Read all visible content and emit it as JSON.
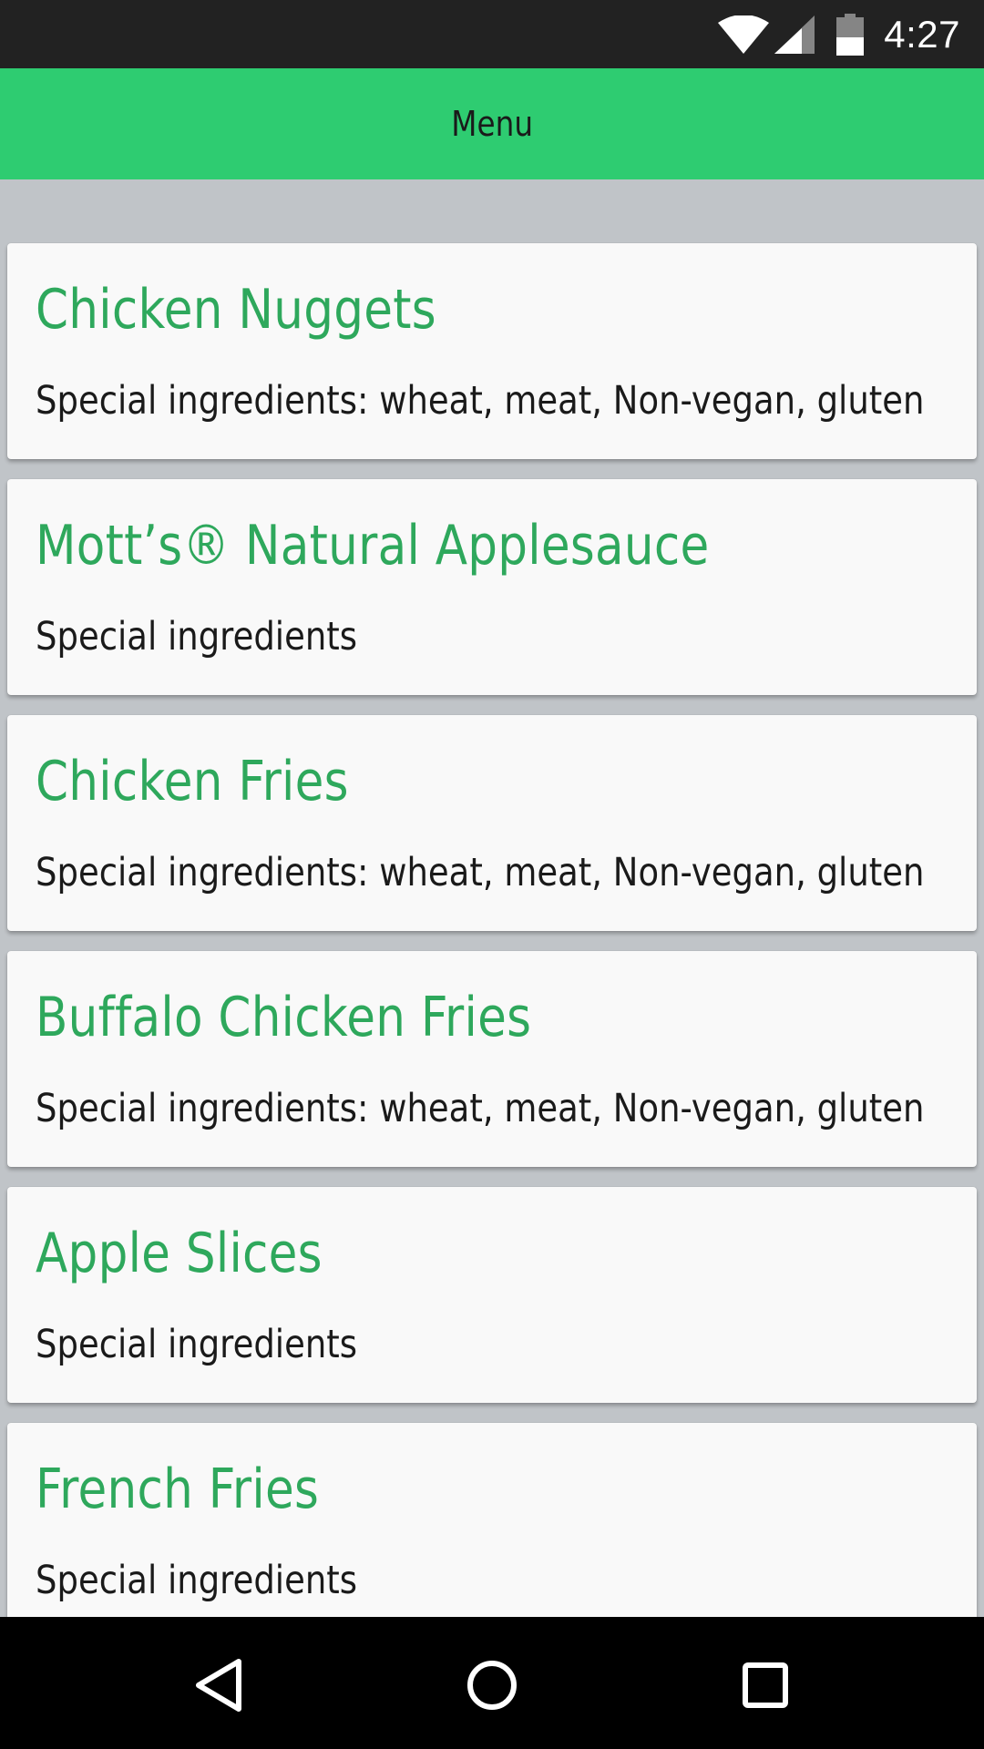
{
  "status_bar": {
    "time": "4:27",
    "icons": [
      "wifi-icon",
      "cell-signal-icon",
      "battery-icon"
    ]
  },
  "app_bar": {
    "title": "Menu",
    "color": "#2ecc71"
  },
  "menu_items": [
    {
      "name": "Chicken Nuggets",
      "ingredients": "Special ingredients: wheat, meat, Non-vegan, gluten"
    },
    {
      "name": "Mott’s® Natural Applesauce",
      "ingredients": "Special ingredients"
    },
    {
      "name": "Chicken Fries",
      "ingredients": "Special ingredients: wheat, meat, Non-vegan, gluten"
    },
    {
      "name": "Buffalo Chicken Fries",
      "ingredients": "Special ingredients: wheat, meat, Non-vegan, gluten"
    },
    {
      "name": "Apple Slices",
      "ingredients": "Special ingredients"
    },
    {
      "name": "French Fries",
      "ingredients": "Special ingredients"
    }
  ],
  "nav_bar": {
    "buttons": [
      "back-icon",
      "home-icon",
      "recent-apps-icon"
    ]
  },
  "colors": {
    "accent_green": "#2ecc71",
    "item_title_green": "#2ea85c",
    "background_gray": "#c0c4c8",
    "card_background": "#f9f9f9"
  }
}
